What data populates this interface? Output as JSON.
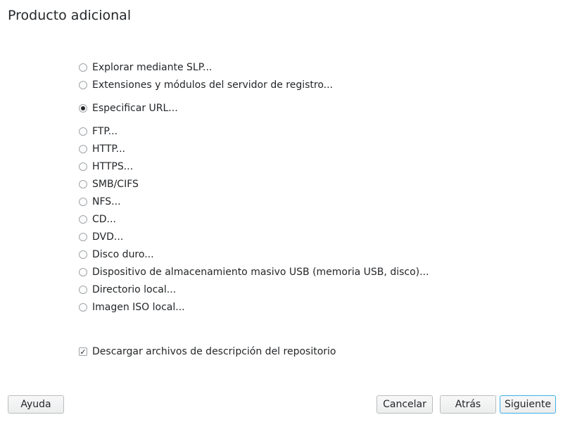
{
  "window": {
    "title": "Producto adicional"
  },
  "sources": [
    {
      "id": "slp",
      "label": "Explorar mediante SLP...",
      "checked": false
    },
    {
      "id": "registry",
      "label": "Extensiones y módulos del servidor de registro...",
      "checked": false
    },
    {
      "id": "url",
      "label": "Especificar URL...",
      "checked": true
    },
    {
      "id": "ftp",
      "label": "FTP...",
      "checked": false
    },
    {
      "id": "http",
      "label": "HTTP...",
      "checked": false
    },
    {
      "id": "https",
      "label": "HTTPS...",
      "checked": false
    },
    {
      "id": "smb",
      "label": "SMB/CIFS",
      "checked": false
    },
    {
      "id": "nfs",
      "label": "NFS...",
      "checked": false
    },
    {
      "id": "cd",
      "label": "CD...",
      "checked": false
    },
    {
      "id": "dvd",
      "label": "DVD...",
      "checked": false
    },
    {
      "id": "hdd",
      "label": "Disco duro...",
      "checked": false
    },
    {
      "id": "usb",
      "label": "Dispositivo de almacenamiento masivo USB (memoria USB, disco)...",
      "checked": false
    },
    {
      "id": "localdir",
      "label": "Directorio local...",
      "checked": false
    },
    {
      "id": "iso",
      "label": "Imagen ISO local...",
      "checked": false
    }
  ],
  "download_descriptions": {
    "label": "Descargar archivos de descripción del repositorio",
    "checked": true
  },
  "buttons": {
    "help": "Ayuda",
    "cancel": "Cancelar",
    "back": "Atrás",
    "next": "Siguiente"
  },
  "colors": {
    "accent": "#3daee9",
    "text": "#232629"
  }
}
